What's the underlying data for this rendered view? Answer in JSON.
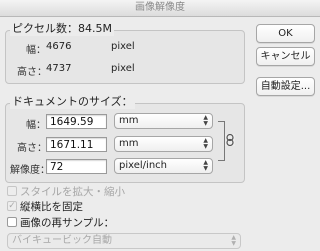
{
  "window": {
    "title": "画像解像度"
  },
  "pixel_dimensions": {
    "title": "ピクセル数：84.5M",
    "width_label": "幅：",
    "width_value": "4676",
    "width_unit": "pixel",
    "height_label": "高さ：",
    "height_value": "4737",
    "height_unit": "pixel"
  },
  "document_size": {
    "title": "ドキュメントのサイズ：",
    "width_label": "幅：",
    "width_value": "1649.59",
    "width_unit": "mm",
    "height_label": "高さ：",
    "height_value": "1671.11",
    "height_unit": "mm",
    "resolution_label": "解像度：",
    "resolution_value": "72",
    "resolution_unit": "pixel/inch"
  },
  "buttons": {
    "ok": "OK",
    "cancel": "キャンセル",
    "auto": "自動設定..."
  },
  "options": {
    "scale_styles": {
      "label": "スタイルを拡大・縮小",
      "checked": false,
      "enabled": false
    },
    "constrain_proportions": {
      "label": "縦横比を固定",
      "checked": true,
      "enabled": false
    },
    "resample": {
      "label": "画像の再サンプル：",
      "checked": false,
      "enabled": true
    },
    "resample_method": {
      "value": "バイキュービック自動",
      "enabled": false
    }
  },
  "icons": {
    "chain": "chain-link-icon",
    "select_arrows": "updown-arrows-icon"
  }
}
